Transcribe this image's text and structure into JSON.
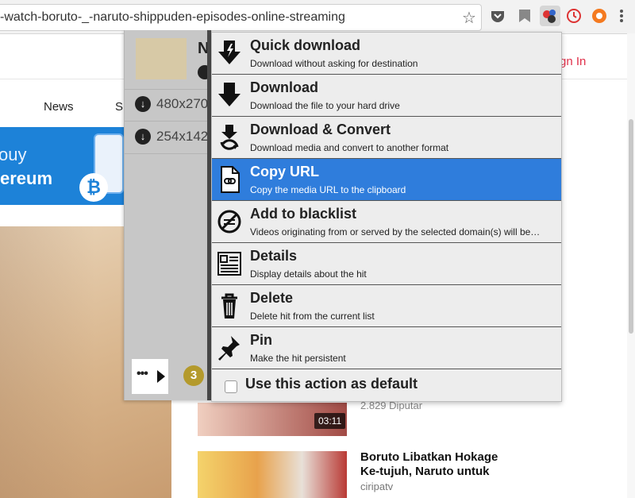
{
  "browser": {
    "url": "-watch-boruto-_-naruto-shippuden-episodes-online-streaming",
    "extensions": [
      "pocket-icon",
      "bookmark-icon",
      "video-downloadhelper-icon",
      "clock-icon",
      "sync-icon",
      "kebab-menu-icon"
    ]
  },
  "page": {
    "nav_news": "News",
    "nav_partial": "Si",
    "signin": "gn In",
    "banner_line1": "ouy",
    "banner_line2": "ereum",
    "banner_coin": "₿",
    "video1_duration": "03:11",
    "video1_views": "2.829 Diputar",
    "video2_title": "Boruto Libatkan Hokage Ke-tujuh, Naruto untuk",
    "video2_channel": "ciripatv"
  },
  "hits": {
    "title_partial": "N",
    "resolutions": [
      "480x270",
      "254x142"
    ],
    "count": "3"
  },
  "menu": {
    "items": [
      {
        "title": "Quick download",
        "desc": "Download without asking for destination",
        "icon": "quick-download-icon"
      },
      {
        "title": "Download",
        "desc": "Download the file to your hard drive",
        "icon": "download-icon"
      },
      {
        "title": "Download & Convert",
        "desc": "Download media and convert to another format",
        "icon": "convert-icon"
      },
      {
        "title": "Copy URL",
        "desc": "Copy the media URL to the clipboard",
        "icon": "link-file-icon"
      },
      {
        "title": "Add to blacklist",
        "desc": "Videos originating from or served by the selected domain(s) will be…",
        "icon": "block-icon"
      },
      {
        "title": "Details",
        "desc": "Display details about the hit",
        "icon": "details-icon"
      },
      {
        "title": "Delete",
        "desc": "Delete hit from the current list",
        "icon": "trash-icon"
      },
      {
        "title": "Pin",
        "desc": "Make the hit persistent",
        "icon": "pin-icon"
      }
    ],
    "selected_index": 3,
    "default_label": "Use this action as default",
    "default_checked": false
  },
  "colors": {
    "selected": "#2f7ddc",
    "signin": "#e0304a",
    "badge": "#b49a2c"
  }
}
